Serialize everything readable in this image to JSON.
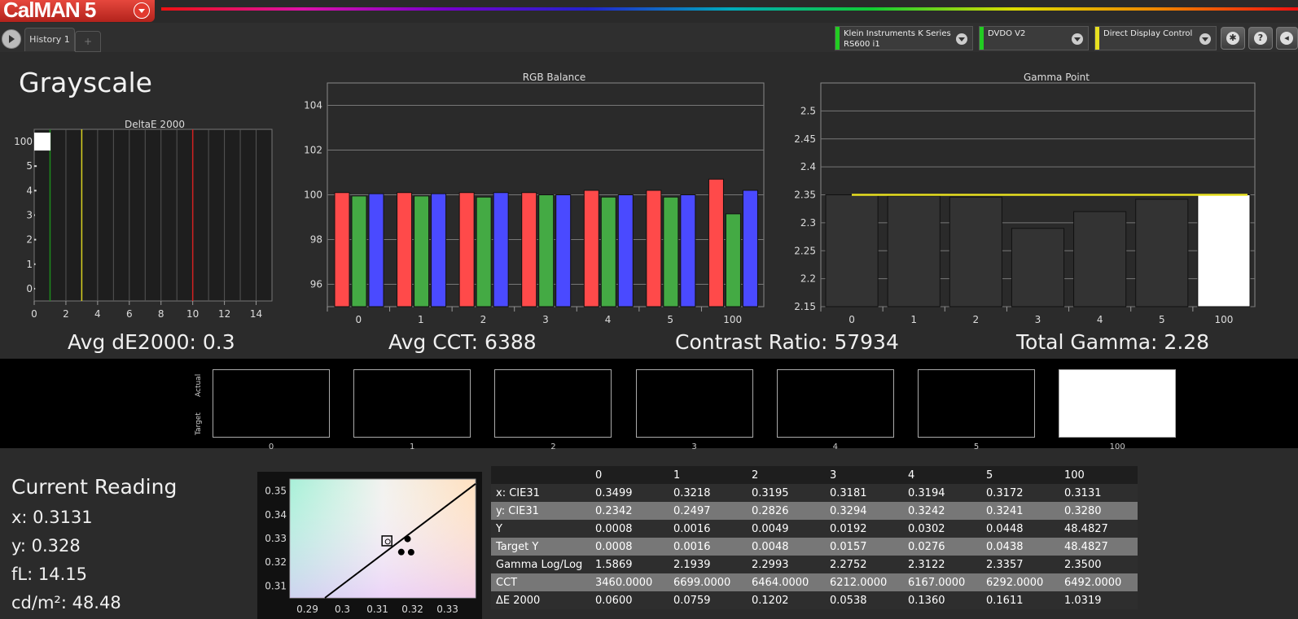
{
  "app": {
    "logo_text": "CalMAN 5"
  },
  "tabs": [
    {
      "label": "History 1"
    },
    {
      "label": "+"
    }
  ],
  "devices": [
    {
      "line1": "Klein Instruments K Series",
      "line2": "RS600 i1",
      "color": "#22cc22"
    },
    {
      "line1": "DVDO V2",
      "line2": "",
      "color": "#22cc22"
    },
    {
      "line1": "Direct Display Control",
      "line2": "",
      "color": "#e8e020"
    }
  ],
  "toolbar_icons": [
    "gear-icon",
    "help-icon",
    "back-icon"
  ],
  "toolbar_icon_glyphs": {
    "help": "?"
  },
  "page_title": "Grayscale",
  "stats": {
    "avg_de": "Avg dE2000: 0.3",
    "avg_cct": "Avg CCT: 6388",
    "contrast": "Contrast Ratio: 57934",
    "gamma": "Total Gamma: 2.28"
  },
  "swatch_labels": {
    "actual": "Actual",
    "target": "Target"
  },
  "swatches": [
    {
      "label": "0",
      "color": "#000000"
    },
    {
      "label": "1",
      "color": "#000000"
    },
    {
      "label": "2",
      "color": "#000000"
    },
    {
      "label": "3",
      "color": "#000000"
    },
    {
      "label": "4",
      "color": "#000000"
    },
    {
      "label": "5",
      "color": "#000000"
    },
    {
      "label": "100",
      "color": "#ffffff"
    }
  ],
  "current_reading": {
    "title": "Current Reading",
    "x": "x: 0.3131",
    "y": "y: 0.328",
    "fl": "fL: 14.15",
    "cdm2": "cd/m²: 48.48"
  },
  "table": {
    "headers": [
      "",
      "0",
      "1",
      "2",
      "3",
      "4",
      "5",
      "100"
    ],
    "rows": [
      {
        "label": "x: CIE31",
        "values": [
          "0.3499",
          "0.3218",
          "0.3195",
          "0.3181",
          "0.3194",
          "0.3172",
          "0.3131"
        ]
      },
      {
        "label": "y: CIE31",
        "values": [
          "0.2342",
          "0.2497",
          "0.2826",
          "0.3294",
          "0.3242",
          "0.3241",
          "0.3280"
        ]
      },
      {
        "label": "Y",
        "values": [
          "0.0008",
          "0.0016",
          "0.0049",
          "0.0192",
          "0.0302",
          "0.0448",
          "48.4827"
        ]
      },
      {
        "label": "Target Y",
        "values": [
          "0.0008",
          "0.0016",
          "0.0048",
          "0.0157",
          "0.0276",
          "0.0438",
          "48.4827"
        ]
      },
      {
        "label": "Gamma Log/Log",
        "values": [
          "1.5869",
          "2.1939",
          "2.2993",
          "2.2752",
          "2.3122",
          "2.3357",
          "2.3500"
        ]
      },
      {
        "label": "CCT",
        "values": [
          "3460.0000",
          "6699.0000",
          "6464.0000",
          "6212.0000",
          "6167.0000",
          "6292.0000",
          "6492.0000"
        ]
      },
      {
        "label": "ΔE 2000",
        "values": [
          "0.0600",
          "0.0759",
          "0.1202",
          "0.0538",
          "0.1360",
          "0.1611",
          "1.0319"
        ]
      }
    ]
  },
  "chart_data": [
    {
      "type": "bar",
      "title": "DeltaE 2000",
      "orientation": "horizontal",
      "categories": [
        "100",
        "5",
        "4",
        "3",
        "2",
        "1",
        "0"
      ],
      "values": [
        1.03,
        0.16,
        0.14,
        0.05,
        0.12,
        0.08,
        0.06
      ],
      "xlim": [
        0,
        15
      ],
      "xticks": [
        "0",
        "2",
        "4",
        "6",
        "8",
        "10",
        "12",
        "14"
      ],
      "threshold_lines": [
        {
          "value": 1,
          "color": "#1c8a1c"
        },
        {
          "value": 3,
          "color": "#d8d020"
        },
        {
          "value": 10,
          "color": "#d02020"
        }
      ],
      "grid": true
    },
    {
      "type": "bar",
      "title": "RGB Balance",
      "categories": [
        "0",
        "1",
        "2",
        "3",
        "4",
        "5",
        "100"
      ],
      "series": [
        {
          "values": [
            100.1,
            100.1,
            100.1,
            100.1,
            100.2,
            100.2,
            100.7
          ],
          "color": "#ff4a4a"
        },
        {
          "values": [
            99.95,
            99.95,
            99.9,
            100.0,
            99.9,
            99.9,
            99.15
          ],
          "color": "#44aa44"
        },
        {
          "values": [
            100.05,
            100.05,
            100.1,
            100.0,
            100.0,
            100.0,
            100.2
          ],
          "color": "#4a4aff"
        }
      ],
      "ylim": [
        95,
        105
      ],
      "yticks": [
        "96",
        "98",
        "100",
        "102",
        "104"
      ],
      "grid": true
    },
    {
      "type": "bar",
      "title": "Gamma Point",
      "categories": [
        "0",
        "1",
        "2",
        "3",
        "4",
        "5",
        "100"
      ],
      "values": [
        2.35,
        2.348,
        2.346,
        2.29,
        2.32,
        2.342,
        2.35
      ],
      "bar_colors": [
        "#333333",
        "#333333",
        "#333333",
        "#333333",
        "#333333",
        "#333333",
        "#ffffff"
      ],
      "target_line": {
        "value": 2.35,
        "color": "#e8e020"
      },
      "ylim": [
        2.15,
        2.55
      ],
      "yticks": [
        "2.15",
        "2.2",
        "2.25",
        "2.3",
        "2.35",
        "2.4",
        "2.45",
        "2.5"
      ],
      "grid": true
    },
    {
      "type": "scatter",
      "title": "",
      "x": [
        0.3186,
        0.3168,
        0.3196
      ],
      "y": [
        0.3298,
        0.3243,
        0.3242
      ],
      "target": {
        "x": 0.3127,
        "y": 0.329
      },
      "locus_line": {
        "x": [
          0.295,
          0.338
        ],
        "y": [
          0.305,
          0.353
        ]
      },
      "xlim": [
        0.285,
        0.338
      ],
      "ylim": [
        0.305,
        0.355
      ],
      "xticks": [
        "0.29",
        "0.3",
        "0.31",
        "0.32",
        "0.33"
      ],
      "yticks": [
        "0.31",
        "0.32",
        "0.33",
        "0.34",
        "0.35"
      ]
    }
  ]
}
